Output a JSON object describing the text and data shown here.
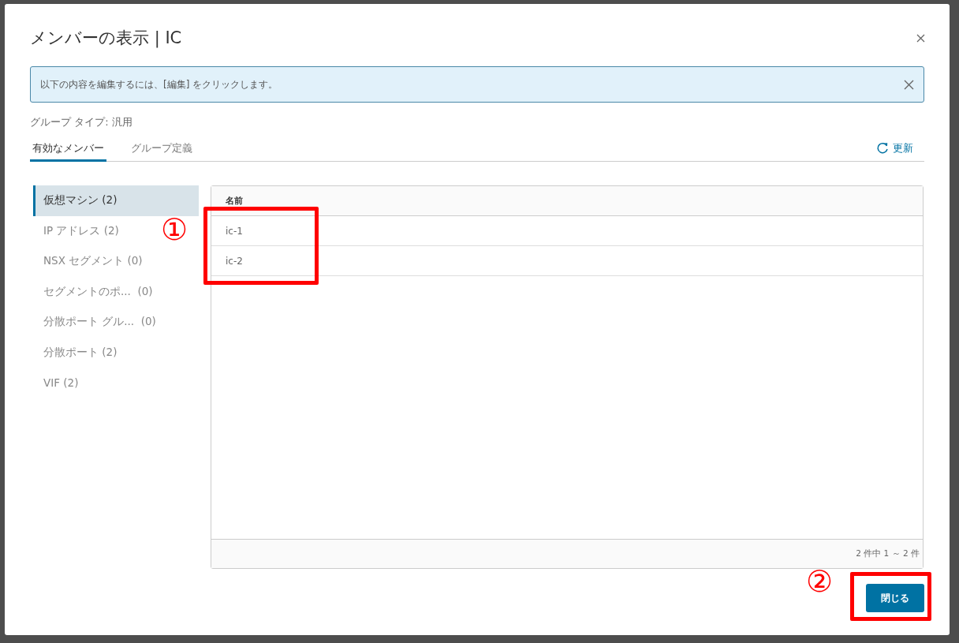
{
  "dialog": {
    "title": "メンバーの表示 | IC"
  },
  "alert": {
    "text": "以下の内容を編集するには、[編集] をクリックします。"
  },
  "group_type": "グループ タイプ: 汎用",
  "tabs": [
    {
      "label": "有効なメンバー",
      "selected": true
    },
    {
      "label": "グループ定義",
      "selected": false
    }
  ],
  "refresh": {
    "label": "更新"
  },
  "sidebar": {
    "items": [
      {
        "label": "仮想マシン (2)",
        "selected": true
      },
      {
        "label": "IP アドレス (2)",
        "selected": false
      },
      {
        "label": "NSX セグメント (0)",
        "selected": false
      },
      {
        "label": "セグメントのポ...  (0)",
        "selected": false
      },
      {
        "label": "分散ポート グル...  (0)",
        "selected": false
      },
      {
        "label": "分散ポート (2)",
        "selected": false
      },
      {
        "label": "VIF (2)",
        "selected": false
      }
    ]
  },
  "table": {
    "columns": [
      "名前"
    ],
    "rows": [
      [
        "ic-1"
      ],
      [
        "ic-2"
      ]
    ],
    "footer": "2 件中 1 ～ 2 件"
  },
  "close_button": {
    "label": "閉じる"
  },
  "callouts": [
    {
      "label": "①"
    },
    {
      "label": "②"
    }
  ]
}
